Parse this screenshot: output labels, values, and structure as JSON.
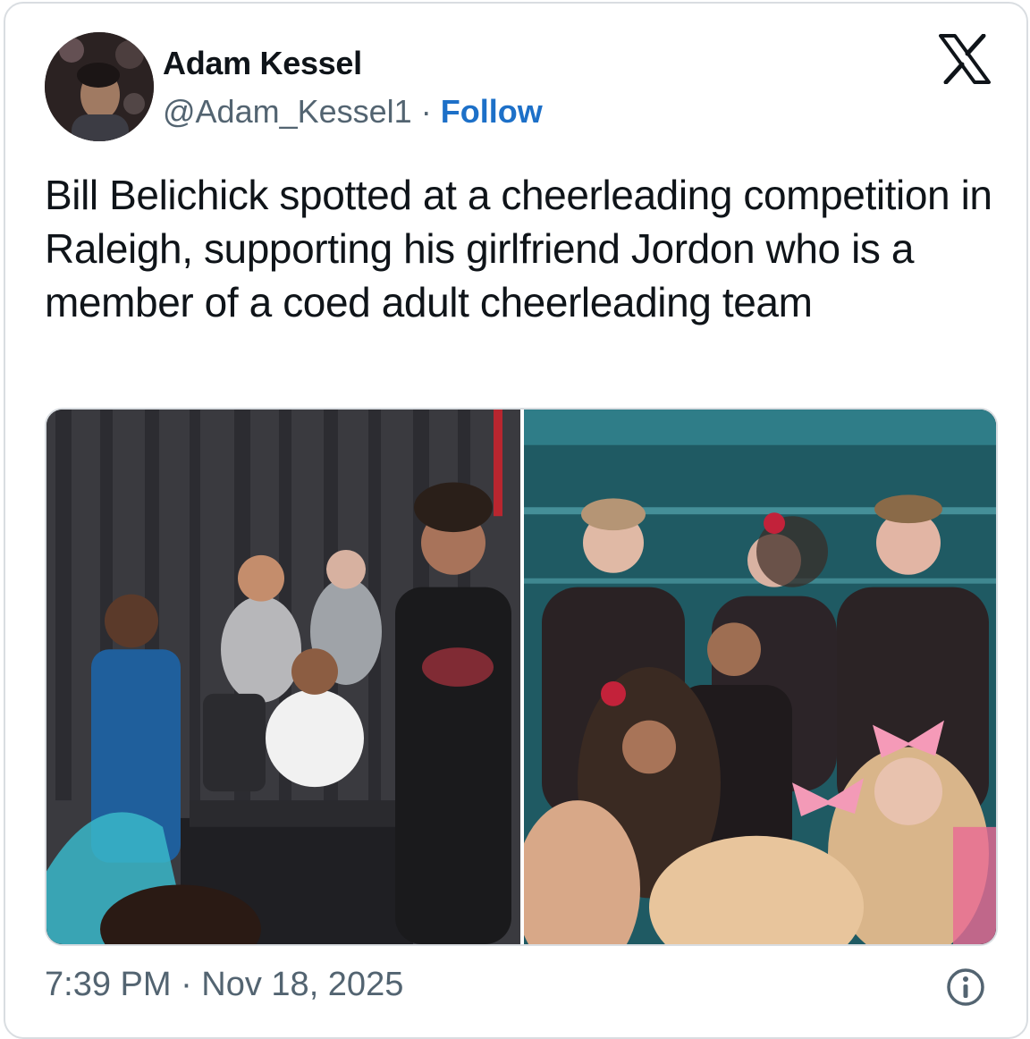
{
  "author": {
    "name": "Adam Kessel",
    "handle": "@Adam_Kessel1",
    "separator": "·",
    "follow_label": "Follow"
  },
  "tweet": {
    "text": "Bill Belichick spotted at a cheerleading competition in Raleigh, supporting his girlfriend Jordon who is a member of a coed adult cheerleading team"
  },
  "footer": {
    "timestamp": "7:39 PM · Nov 18, 2025"
  },
  "icons": {
    "platform": "x-logo-icon",
    "info": "info-icon"
  },
  "colors": {
    "follow_link": "#1d70c8",
    "secondary_text": "#536471",
    "border": "#d9dde1"
  }
}
